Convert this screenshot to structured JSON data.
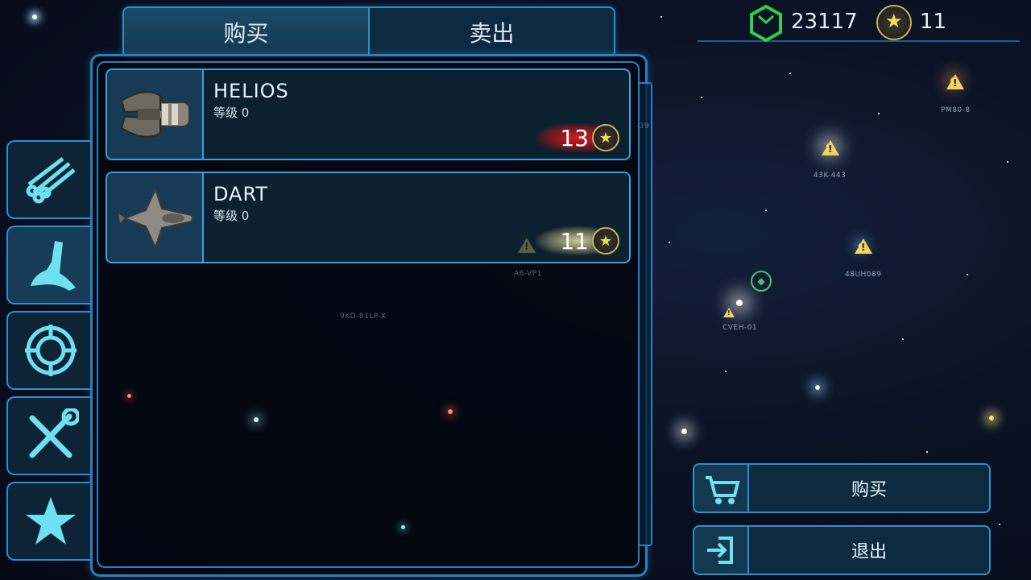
{
  "tabs": {
    "buy": "购买",
    "sell": "卖出"
  },
  "currency": {
    "credits": "23117",
    "stars": "11",
    "credits_icon": "hex-cube-icon",
    "stars_icon": "star-coin-icon"
  },
  "ships": [
    {
      "name": "HELIOS",
      "level": "等级 0",
      "price": "13",
      "price_state": "unaffordable",
      "icon": "helios-ship-icon"
    },
    {
      "name": "DART",
      "level": "等级 0",
      "price": "11",
      "price_state": "affordable",
      "icon": "dart-ship-icon"
    }
  ],
  "side_tabs": [
    "materials-icon",
    "ship-hull-icon",
    "target-icon",
    "tools-icon",
    "star-icon"
  ],
  "map_labels": [
    "PM80-8",
    "43K-443",
    "48UH089",
    "CVEH-01",
    "A6-VP1",
    "9KD-81LP-X",
    "-39"
  ],
  "actions": {
    "buy": "购买",
    "exit": "退出"
  },
  "colors": {
    "accent": "#2f8fd0",
    "price_red": "#d81e1e",
    "price_gold": "#f0e6aa",
    "credits_green": "#2fd14a",
    "star_gold": "#f1d95a"
  }
}
